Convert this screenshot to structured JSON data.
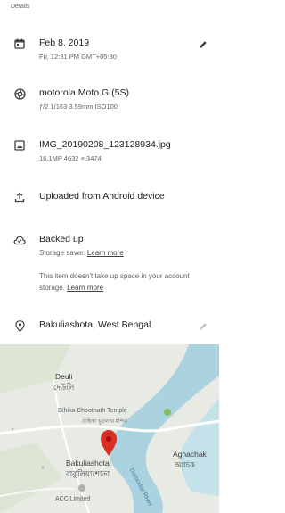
{
  "header": {
    "title": "Details"
  },
  "date": {
    "icon": "calendar-icon",
    "title": "Feb 8, 2019",
    "subtitle": "Fri, 12:31 PM   GMT+05:30"
  },
  "camera": {
    "icon": "camera-aperture-icon",
    "title": "motorola Moto G (5S)",
    "subtitle": "ƒ/2   1/163   3.59mm   ISO100"
  },
  "file": {
    "icon": "image-icon",
    "title": "IMG_20190208_123128934.jpg",
    "subtitle": "16.1MP   4632 × 3474"
  },
  "upload": {
    "icon": "upload-icon",
    "title": "Uploaded from Android device"
  },
  "backup": {
    "icon": "cloud-done-icon",
    "title": "Backed up",
    "saver_text": "Storage saver.",
    "saver_link": "Learn more",
    "storage_text": "This item doesn't take up space in your account storage.",
    "storage_link": "Learn more"
  },
  "location": {
    "icon": "location-pin-icon",
    "title": "Bakuliashota, West Bengal"
  },
  "map": {
    "labels": {
      "deuli_en": "Deuli",
      "deuli_bn": "দেউলি",
      "temple": "Dihika Bhootnath Temple",
      "temple_sub": "গুহিকা ভূতনাথ মন্দির",
      "bakuliashota_en": "Bakuliashota",
      "bakuliashota_bn": "বাকুলিয়াশোতা",
      "agnachak_en": "Agnachak",
      "agnachak_bn": "অগ্নচক",
      "river": "Damodar River",
      "acc": "ACC Limited"
    },
    "colors": {
      "land": "#e8ebe4",
      "water": "#aad3df",
      "road": "#ffffff",
      "pin": "#d93025"
    }
  }
}
